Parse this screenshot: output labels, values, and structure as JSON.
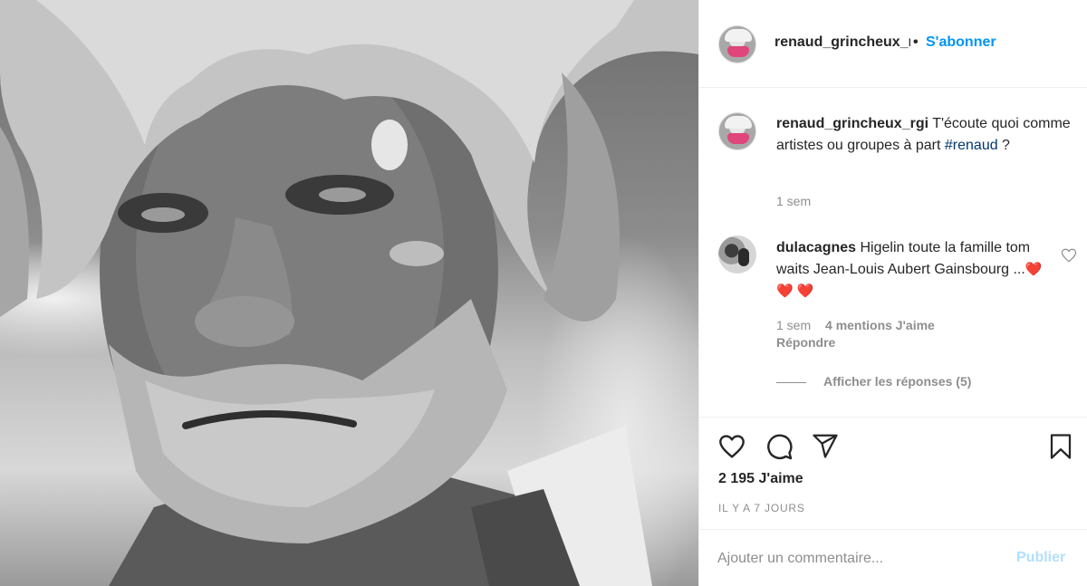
{
  "post": {
    "image_alt": "Black and white close-up portrait of an older man with shaggy blond hair and a grey beard"
  },
  "header": {
    "username": "renaud_grincheux_rgi",
    "separator": "•",
    "follow_label": "S'abonner"
  },
  "caption": {
    "username": "renaud_grincheux_rgi",
    "text": "T'écoute quoi comme artistes ou groupes à part",
    "hashtag": "#renaud",
    "suffix": " ?",
    "time": "1 sem"
  },
  "comment": {
    "username": "dulacagnes",
    "text": "Higelin toute la famille tom waits Jean-Louis Aubert Gainsbourg ...",
    "hearts": "❤️ ❤️ ❤️",
    "time": "1 sem",
    "likes": "4 mentions J'aime",
    "reply_label": "Répondre",
    "view_replies": "Afficher les réponses (5)"
  },
  "actions": {
    "icons": [
      "heart-icon",
      "comment-icon",
      "share-icon",
      "bookmark-icon"
    ],
    "like_count": "2 195 J'aime",
    "date": "IL Y A 7 JOURS"
  },
  "add_comment": {
    "placeholder": "Ajouter un commentaire...",
    "publish_label": "Publier"
  },
  "colors": {
    "accent": "#0095f6",
    "hashtag": "#00376b",
    "muted": "#8e8e8e",
    "publish_disabled": "#b2dffc",
    "heart": "#e0162b"
  }
}
